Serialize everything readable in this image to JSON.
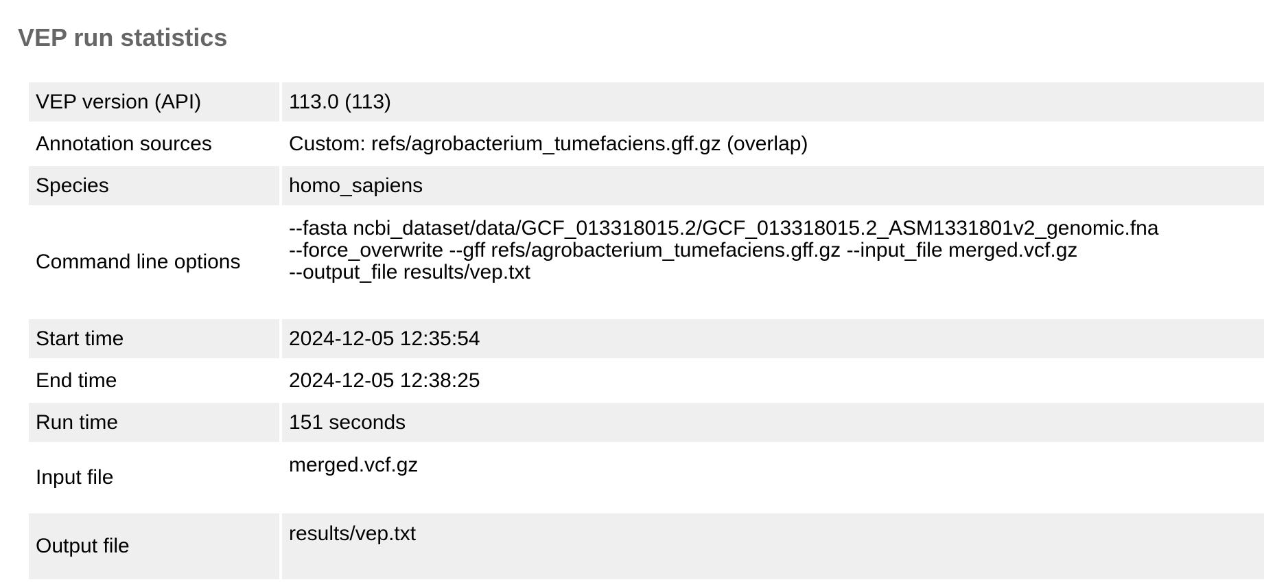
{
  "page": {
    "title": "VEP run statistics"
  },
  "rows": [
    {
      "label": "VEP version (API)",
      "value": "113.0 (113)"
    },
    {
      "label": "Annotation sources",
      "value": "Custom: refs/agrobacterium_tumefaciens.gff.gz (overlap)"
    },
    {
      "label": "Species",
      "value": "homo_sapiens"
    },
    {
      "label": "Command line options",
      "lines": [
        "--fasta ncbi_dataset/data/GCF_013318015.2/GCF_013318015.2_ASM1331801v2_genomic.fna",
        "--force_overwrite --gff refs/agrobacterium_tumefaciens.gff.gz --input_file merged.vcf.gz",
        "--output_file results/vep.txt"
      ]
    },
    {
      "label": "Start time",
      "value": "2024-12-05 12:35:54"
    },
    {
      "label": "End time",
      "value": "2024-12-05 12:38:25"
    },
    {
      "label": "Run time",
      "value": "151 seconds"
    },
    {
      "label": "Input file",
      "value": "merged.vcf.gz"
    },
    {
      "label": "Output file",
      "value": "results/vep.txt"
    }
  ],
  "colors": {
    "title": "#666666",
    "row_shade": "#efefef",
    "text": "#000000"
  }
}
